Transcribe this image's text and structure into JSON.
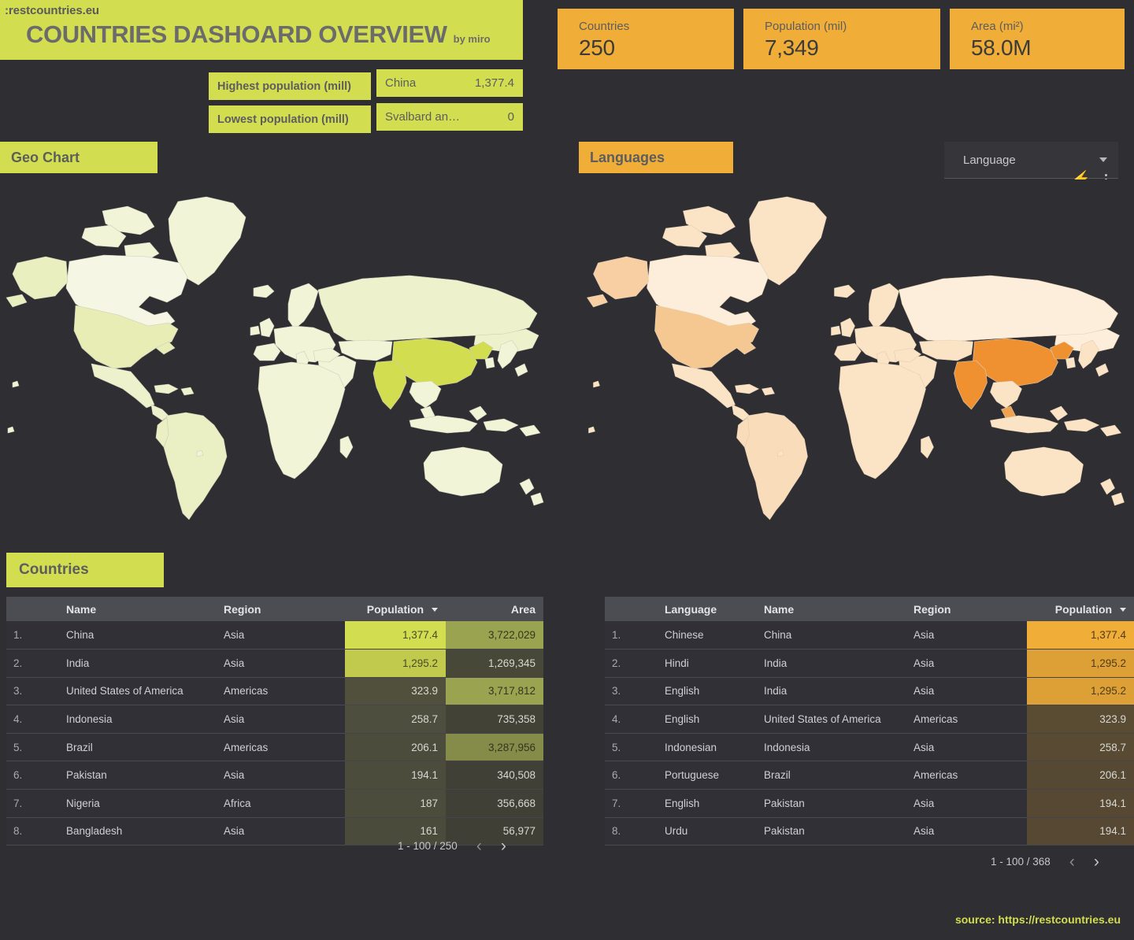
{
  "header": {
    "brand": ":restcountries.eu",
    "title": "COUNTRIES DASHOARD OVERVIEW",
    "byline": "by miro"
  },
  "kpis": [
    {
      "label": "Countries",
      "value": "250"
    },
    {
      "label": "Population (mil)",
      "value": "7,349"
    },
    {
      "label": "Area (mi²)",
      "value": "58.0M"
    }
  ],
  "extremes": {
    "highest_label": "Highest population (mill)",
    "highest_name": "China",
    "highest_value": "1,377.4",
    "lowest_label": "Lowest population (mill)",
    "lowest_name": "Svalbard an…",
    "lowest_value": "0"
  },
  "sections": {
    "geo_chart": "Geo Chart",
    "languages": "Languages",
    "countries": "Countries"
  },
  "filter": {
    "label": "Language"
  },
  "countries_table": {
    "columns": [
      "",
      "Name",
      "Region",
      "Population",
      "Area"
    ],
    "sorted_by": "Population",
    "rows": [
      {
        "idx": "1.",
        "name": "China",
        "region": "Asia",
        "population": "1,377.4",
        "area": "3,722,029"
      },
      {
        "idx": "2.",
        "name": "India",
        "region": "Asia",
        "population": "1,295.2",
        "area": "1,269,345"
      },
      {
        "idx": "3.",
        "name": "United States of America",
        "region": "Americas",
        "population": "323.9",
        "area": "3,717,812"
      },
      {
        "idx": "4.",
        "name": "Indonesia",
        "region": "Asia",
        "population": "258.7",
        "area": "735,358"
      },
      {
        "idx": "5.",
        "name": "Brazil",
        "region": "Americas",
        "population": "206.1",
        "area": "3,287,956"
      },
      {
        "idx": "6.",
        "name": "Pakistan",
        "region": "Asia",
        "population": "194.1",
        "area": "340,508"
      },
      {
        "idx": "7.",
        "name": "Nigeria",
        "region": "Africa",
        "population": "187",
        "area": "356,668"
      },
      {
        "idx": "8.",
        "name": "Bangladesh",
        "region": "Asia",
        "population": "161",
        "area": "56,977"
      }
    ],
    "pagination": {
      "range": "1 - 100 / 250",
      "prev": "‹",
      "next": "›"
    }
  },
  "languages_table": {
    "columns": [
      "",
      "Language",
      "Name",
      "Region",
      "Population"
    ],
    "sorted_by": "Population",
    "rows": [
      {
        "idx": "1.",
        "language": "Chinese",
        "name": "China",
        "region": "Asia",
        "population": "1,377.4"
      },
      {
        "idx": "2.",
        "language": "Hindi",
        "name": "India",
        "region": "Asia",
        "population": "1,295.2"
      },
      {
        "idx": "3.",
        "language": "English",
        "name": "India",
        "region": "Asia",
        "population": "1,295.2"
      },
      {
        "idx": "4.",
        "language": "English",
        "name": "United States of America",
        "region": "Americas",
        "population": "323.9"
      },
      {
        "idx": "5.",
        "language": "Indonesian",
        "name": "Indonesia",
        "region": "Asia",
        "population": "258.7"
      },
      {
        "idx": "6.",
        "language": "Portuguese",
        "name": "Brazil",
        "region": "Americas",
        "population": "206.1"
      },
      {
        "idx": "7.",
        "language": "English",
        "name": "Pakistan",
        "region": "Asia",
        "population": "194.1"
      },
      {
        "idx": "8.",
        "language": "Urdu",
        "name": "Pakistan",
        "region": "Asia",
        "population": "194.1"
      }
    ],
    "pagination": {
      "range": "1 - 100 / 368",
      "prev": "‹",
      "next": "›"
    }
  },
  "footer": {
    "source": "source: https://restcountries.eu"
  },
  "colors": {
    "background": "#2f2f33",
    "accent_green": "#d3dd50",
    "accent_orange": "#f0ad38",
    "map_base_green": "#f2f4d8",
    "map_high_green": "#d3dd50",
    "map_base_orange": "#fbe3c6",
    "map_high_orange": "#ef9031",
    "table_header": "#4c4c53",
    "row_bg": "#303036"
  },
  "chart_data": [
    {
      "type": "heatmap",
      "title": "Geo Chart",
      "metric": "Population (mil)",
      "palette": [
        "#f2f4d8",
        "#d3dd50"
      ],
      "regions": [
        {
          "name": "China",
          "value": 1377.4
        },
        {
          "name": "India",
          "value": 1295.2
        },
        {
          "name": "United States of America",
          "value": 323.9
        },
        {
          "name": "Indonesia",
          "value": 258.7
        },
        {
          "name": "Brazil",
          "value": 206.1
        },
        {
          "name": "Pakistan",
          "value": 194.1
        },
        {
          "name": "Nigeria",
          "value": 187
        },
        {
          "name": "Bangladesh",
          "value": 161
        }
      ]
    },
    {
      "type": "heatmap",
      "title": "Languages",
      "metric": "Population (mil)",
      "palette": [
        "#fbe3c6",
        "#ef9031"
      ],
      "regions": [
        {
          "name": "China",
          "value": 1377.4
        },
        {
          "name": "India",
          "value": 1295.2
        },
        {
          "name": "United States of America",
          "value": 323.9
        },
        {
          "name": "Indonesia",
          "value": 258.7
        },
        {
          "name": "Brazil",
          "value": 206.1
        },
        {
          "name": "Pakistan",
          "value": 194.1
        },
        {
          "name": "Nigeria",
          "value": 187
        },
        {
          "name": "Bangladesh",
          "value": 161
        }
      ]
    },
    {
      "type": "table",
      "title": "Countries",
      "columns": [
        "Name",
        "Region",
        "Population",
        "Area"
      ],
      "rows": [
        [
          "China",
          "Asia",
          1377.4,
          3722029
        ],
        [
          "India",
          "Asia",
          1295.2,
          1269345
        ],
        [
          "United States of America",
          "Americas",
          323.9,
          3717812
        ],
        [
          "Indonesia",
          "Asia",
          258.7,
          735358
        ],
        [
          "Brazil",
          "Americas",
          206.1,
          3287956
        ],
        [
          "Pakistan",
          "Asia",
          194.1,
          340508
        ],
        [
          "Nigeria",
          "Africa",
          187,
          356668
        ],
        [
          "Bangladesh",
          "Asia",
          161,
          56977
        ]
      ]
    },
    {
      "type": "table",
      "title": "Languages",
      "columns": [
        "Language",
        "Name",
        "Region",
        "Population"
      ],
      "rows": [
        [
          "Chinese",
          "China",
          "Asia",
          1377.4
        ],
        [
          "Hindi",
          "India",
          "Asia",
          1295.2
        ],
        [
          "English",
          "India",
          "Asia",
          1295.2
        ],
        [
          "English",
          "United States of America",
          "Americas",
          323.9
        ],
        [
          "Indonesian",
          "Indonesia",
          "Asia",
          258.7
        ],
        [
          "Portuguese",
          "Brazil",
          "Americas",
          206.1
        ],
        [
          "English",
          "Pakistan",
          "Asia",
          194.1
        ],
        [
          "Urdu",
          "Pakistan",
          "Asia",
          194.1
        ]
      ]
    }
  ]
}
